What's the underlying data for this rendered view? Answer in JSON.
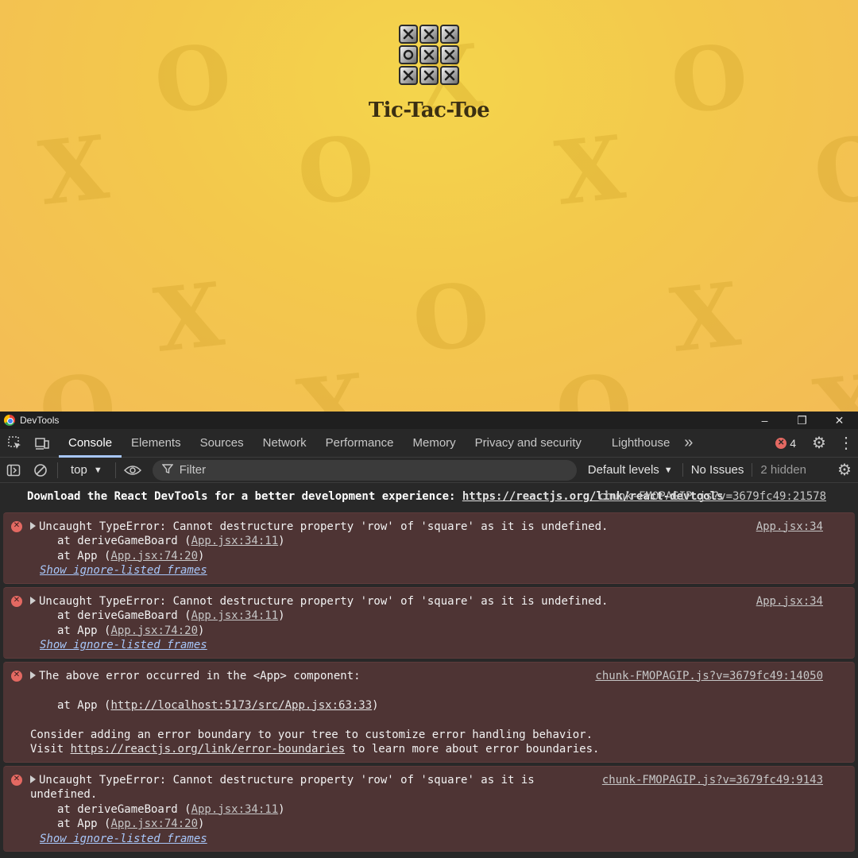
{
  "app": {
    "title": "Tic-Tac-Toe",
    "logo_cells": [
      "x",
      "x",
      "x",
      "o",
      "x",
      "x",
      "x",
      "x",
      "x"
    ],
    "background_marks": [
      "O",
      "X",
      "O",
      "X",
      "O",
      "X",
      "O",
      "X",
      "O",
      "X",
      "O",
      "X",
      "O",
      "X",
      "O",
      "X",
      "O",
      "X"
    ]
  },
  "devtools": {
    "window_title": "DevTools",
    "window_controls": [
      "–",
      "❐",
      "✕"
    ],
    "tabs": [
      "Console",
      "Elements",
      "Sources",
      "Network",
      "Performance",
      "Memory",
      "Privacy and security",
      "Lighthouse"
    ],
    "active_tab": "Console",
    "more_tabs": "»",
    "error_count": "4",
    "toolbar": {
      "context": "top",
      "filter_placeholder": "Filter",
      "levels": "Default levels",
      "issues": "No Issues",
      "hidden": "2 hidden"
    },
    "messages": [
      {
        "type": "info",
        "source": "chunk-FMOPAGIP.js?v=3679fc49:21578",
        "text": "Download the React DevTools for a better development experience: ",
        "link": "https://reactjs.org/link/react-devtools"
      },
      {
        "type": "error",
        "source": "App.jsx:34",
        "head": "Uncaught TypeError: Cannot destructure property 'row' of 'square' as it is undefined.",
        "stack": [
          {
            "prefix": "at deriveGameBoard (",
            "link": "App.jsx:34:11",
            "suffix": ")"
          },
          {
            "prefix": "at App (",
            "link": "App.jsx:74:20",
            "suffix": ")"
          }
        ],
        "ignore": "Show ignore-listed frames"
      },
      {
        "type": "error",
        "source": "App.jsx:34",
        "head": "Uncaught TypeError: Cannot destructure property 'row' of 'square' as it is undefined.",
        "stack": [
          {
            "prefix": "at deriveGameBoard (",
            "link": "App.jsx:34:11",
            "suffix": ")"
          },
          {
            "prefix": "at App (",
            "link": "App.jsx:74:20",
            "suffix": ")"
          }
        ],
        "ignore": "Show ignore-listed frames"
      },
      {
        "type": "error",
        "source": "chunk-FMOPAGIP.js?v=3679fc49:14050",
        "head": "The above error occurred in the <App> component:",
        "stack_url": {
          "prefix": "at App (",
          "link": "http://localhost:5173/src/App.jsx:63:33",
          "suffix": ")"
        },
        "tail1": "Consider adding an error boundary to your tree to customize error handling behavior.",
        "tail2_prefix": "Visit ",
        "tail2_link": "https://reactjs.org/link/error-boundaries",
        "tail2_suffix": " to learn more about error boundaries."
      },
      {
        "type": "error",
        "source": "chunk-FMOPAGIP.js?v=3679fc49:9143",
        "head": "Uncaught TypeError: Cannot destructure property 'row' of 'square' as it is",
        "head_cont": "undefined.",
        "stack": [
          {
            "prefix": "at deriveGameBoard (",
            "link": "App.jsx:34:11",
            "suffix": ")"
          },
          {
            "prefix": "at App (",
            "link": "App.jsx:74:20",
            "suffix": ")"
          }
        ],
        "ignore": "Show ignore-listed frames"
      }
    ],
    "colors": {
      "page_yellow": "#f3c64a",
      "devtools_bg": "#282828",
      "error_row_bg": "#4e3434",
      "error_icon": "#e46962",
      "active_tab_underline": "#a8c7fa"
    }
  }
}
